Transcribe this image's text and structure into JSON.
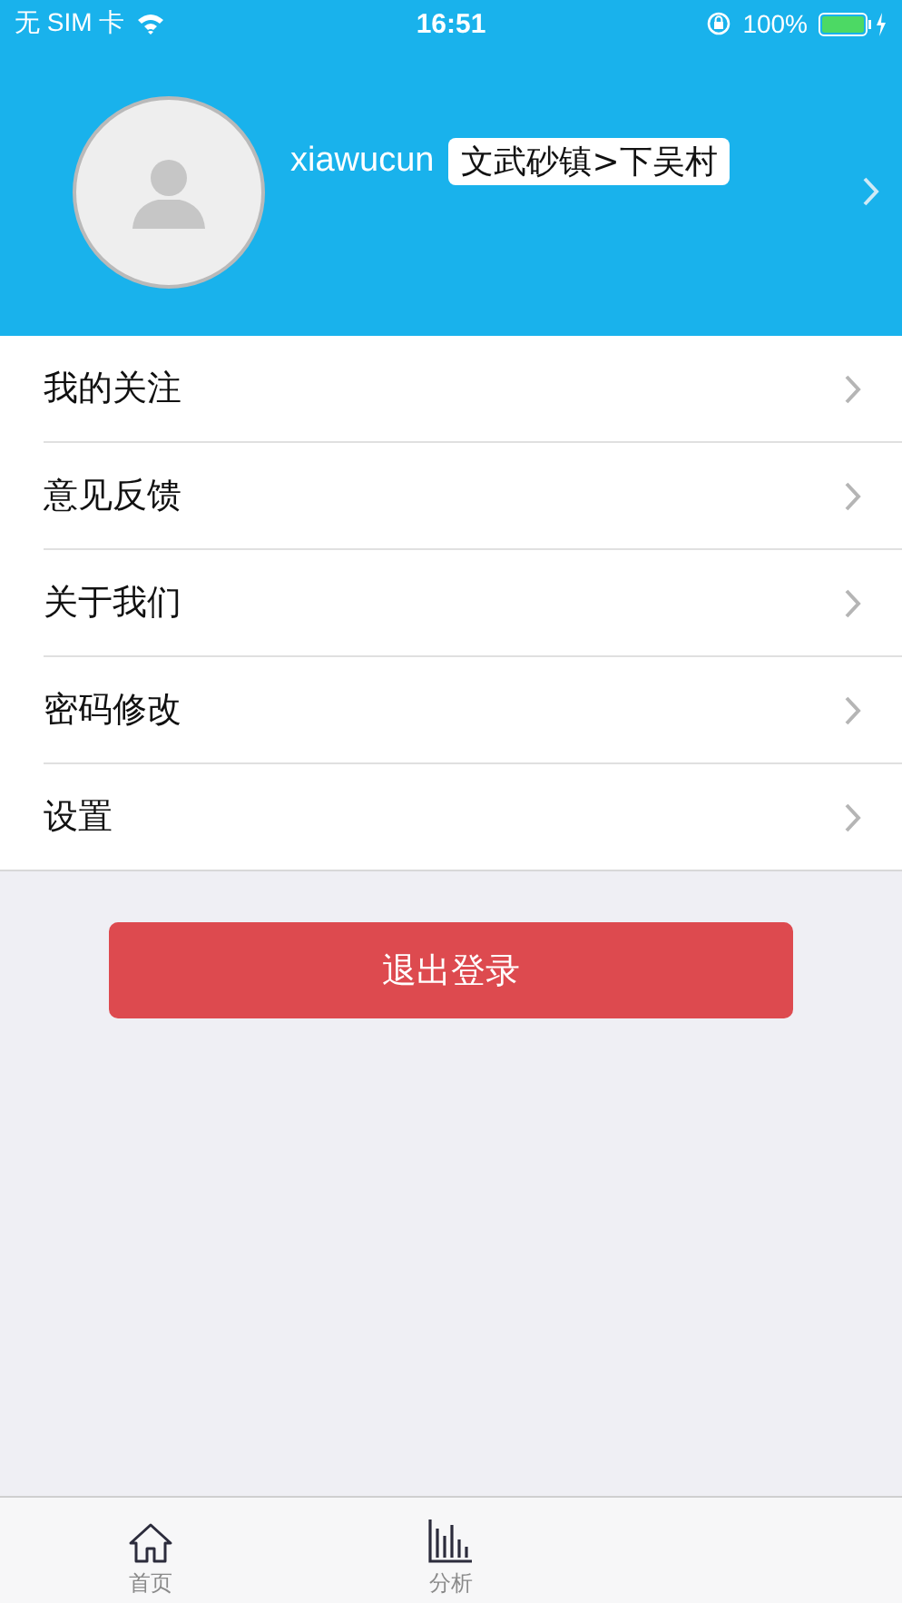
{
  "status_bar": {
    "carrier": "无 SIM 卡",
    "time": "16:51",
    "battery": "100%"
  },
  "profile": {
    "username": "xiawucun",
    "location": "文武砂镇>下吴村"
  },
  "menu": [
    {
      "label": "我的关注"
    },
    {
      "label": "意见反馈"
    },
    {
      "label": "关于我们"
    },
    {
      "label": "密码修改"
    },
    {
      "label": "设置"
    }
  ],
  "logout_button": "退出登录",
  "tab_bar": [
    {
      "label": "首页",
      "kind": "home",
      "selected": false
    },
    {
      "label": "分析",
      "kind": "chart",
      "selected": false
    }
  ]
}
